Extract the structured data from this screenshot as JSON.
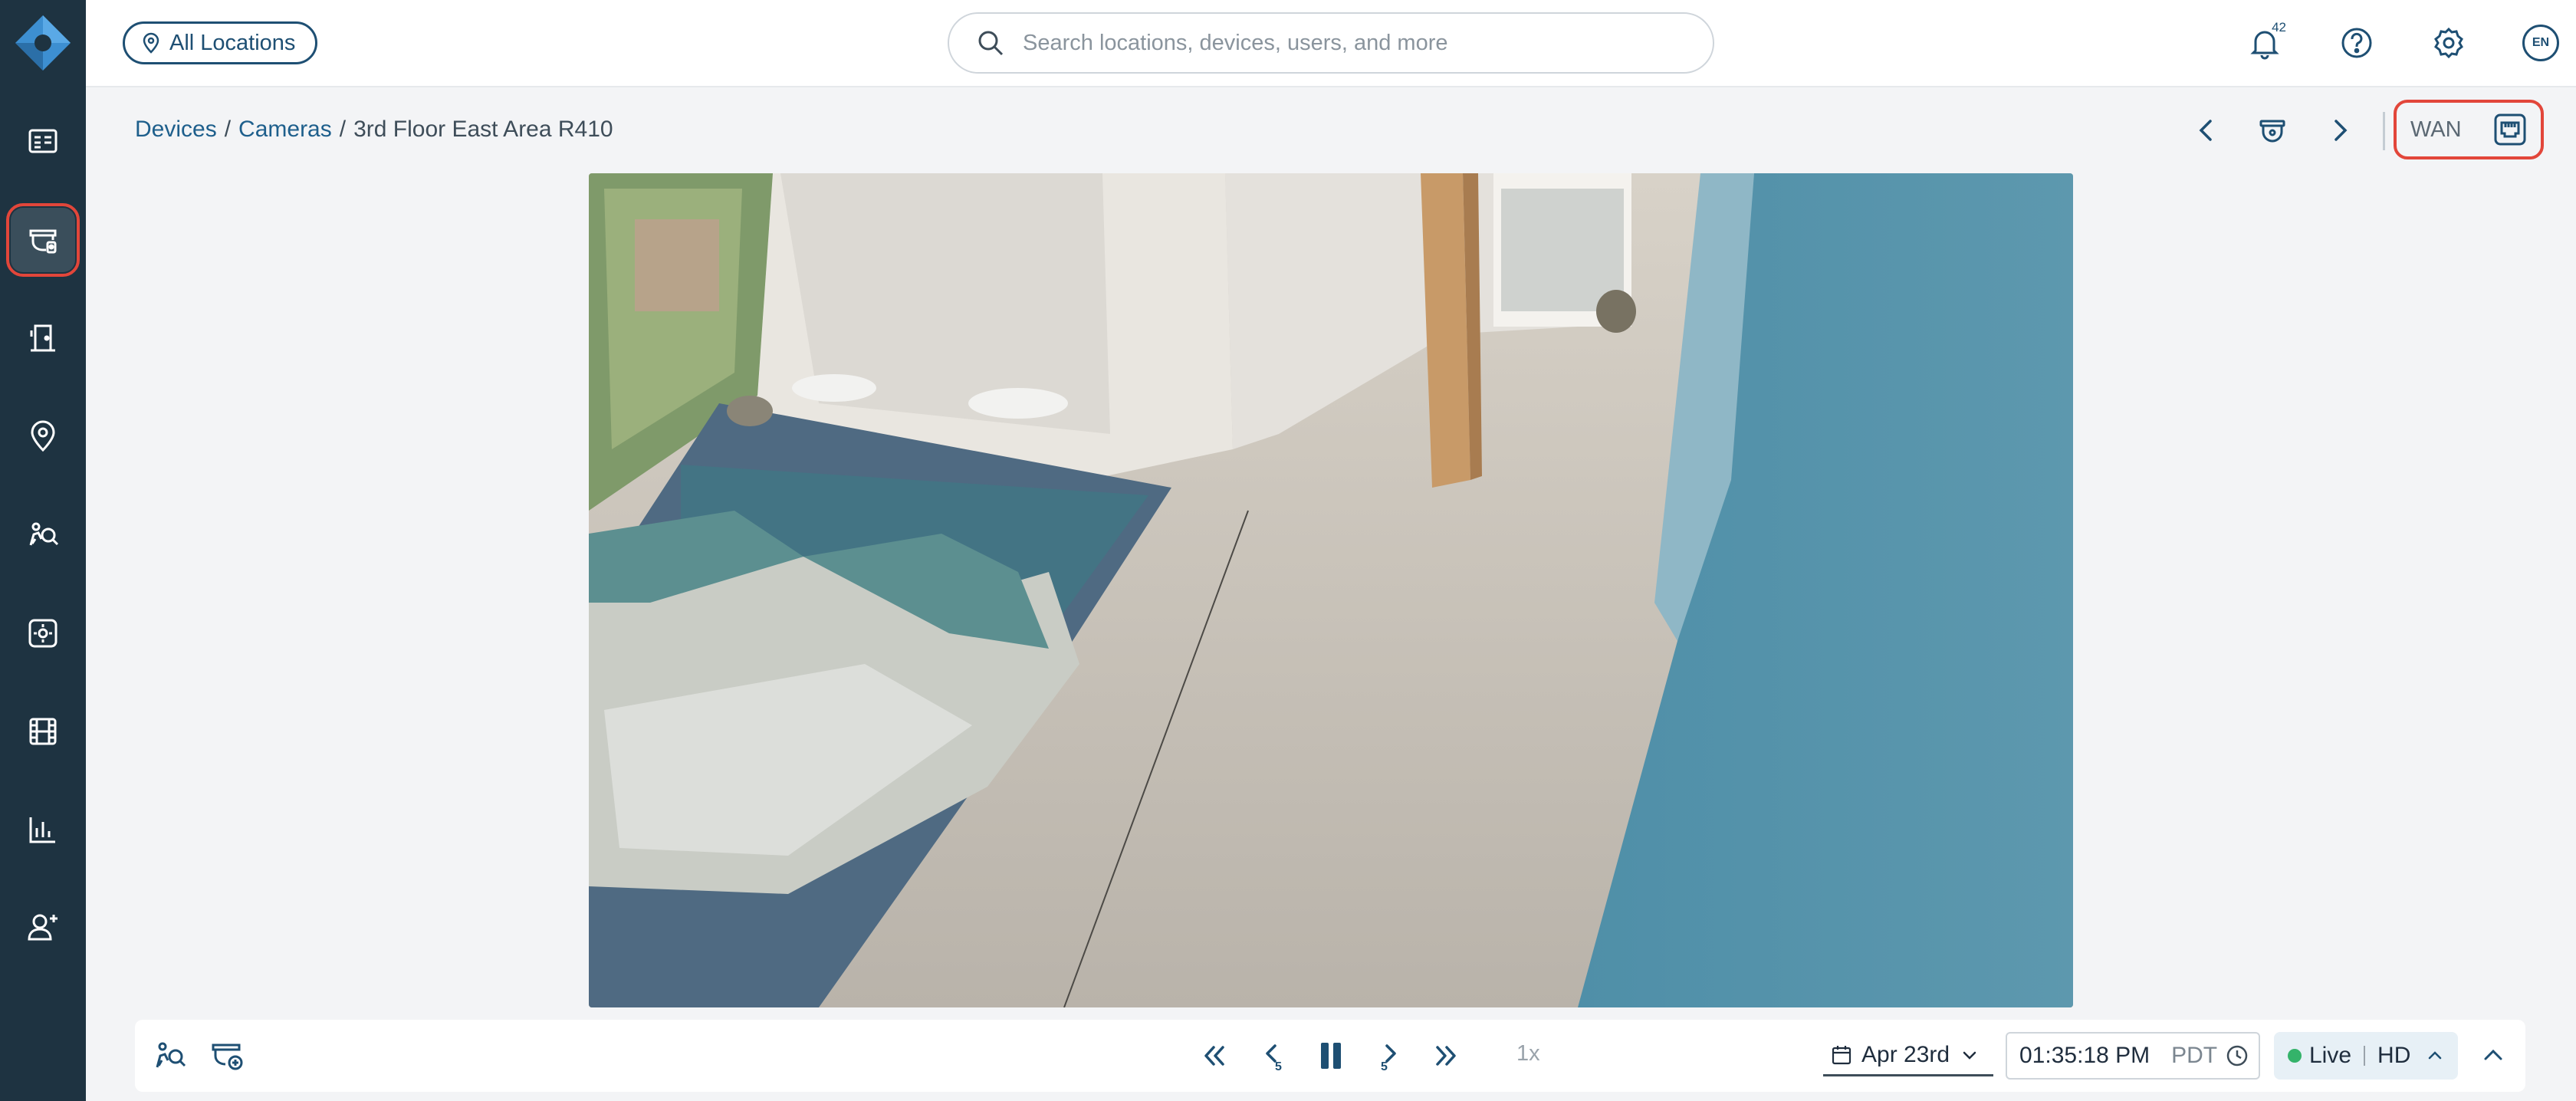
{
  "colors": {
    "sidebar_bg": "#1e3341",
    "accent": "#1e5f8c",
    "highlight_outline": "#e2463a",
    "live_dot": "#34b36a"
  },
  "sidebar": {
    "items": [
      {
        "name": "dashboard-icon",
        "active": false
      },
      {
        "name": "camera-icon",
        "active": true
      },
      {
        "name": "door-access-icon",
        "active": false
      },
      {
        "name": "location-pin-icon",
        "active": false
      },
      {
        "name": "people-search-icon",
        "active": false
      },
      {
        "name": "sensor-icon",
        "active": false
      },
      {
        "name": "film-icon",
        "active": false
      },
      {
        "name": "analytics-icon",
        "active": false
      },
      {
        "name": "add-user-icon",
        "active": false
      }
    ]
  },
  "header": {
    "location_label": "All Locations",
    "search_placeholder": "Search locations, devices, users, and more",
    "notifications_count": "42",
    "language": "EN"
  },
  "breadcrumb": {
    "items": [
      {
        "label": "Devices",
        "link": true
      },
      {
        "label": "Cameras",
        "link": true
      },
      {
        "label": "3rd Floor East Area R410",
        "link": false
      }
    ],
    "separator": "/"
  },
  "camera_nav": {
    "connection_label": "WAN"
  },
  "playback": {
    "speed": "1x",
    "skip_seconds": "5",
    "date": "Apr 23rd",
    "time": "01:35:18 PM",
    "timezone": "PDT",
    "mode": "Live",
    "quality": "HD",
    "state": "playing"
  }
}
